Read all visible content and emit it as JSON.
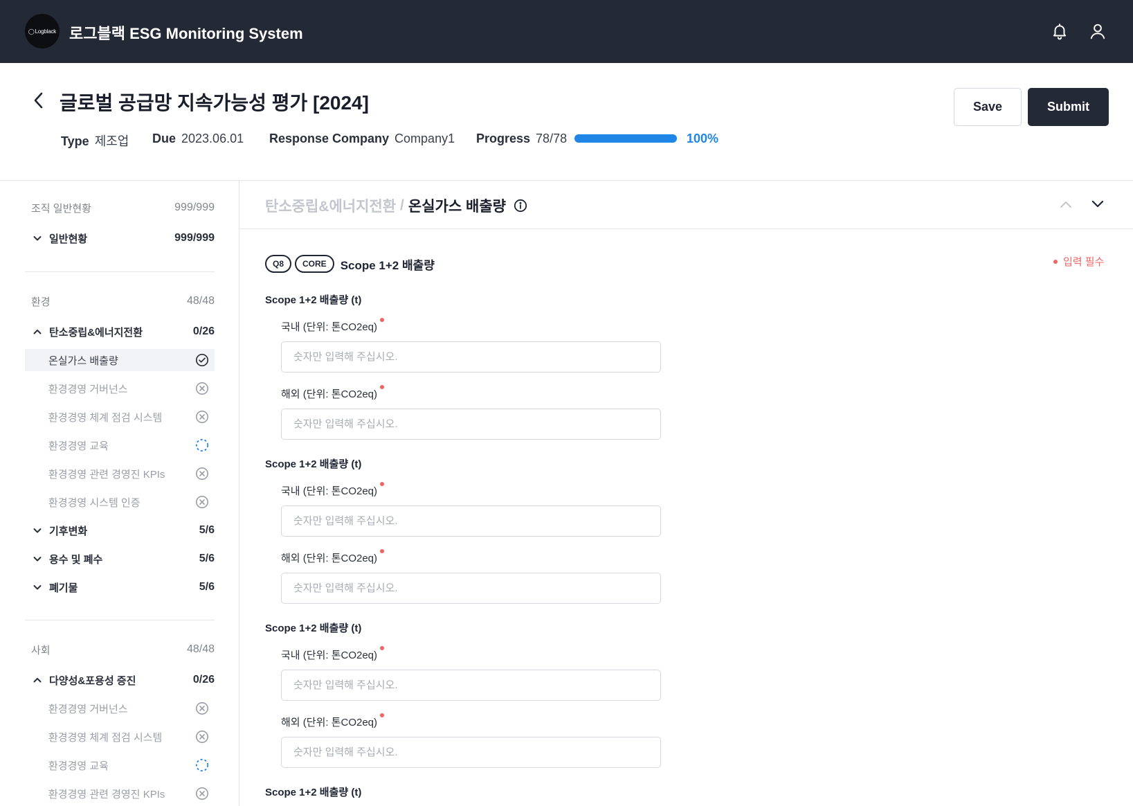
{
  "app": {
    "logo_text": "Logblack",
    "title": "로그블랙 ESG Monitoring System"
  },
  "header": {
    "title": "글로벌 공급망 지속가능성 평가 [2024]",
    "meta": {
      "type_label": "Type",
      "type_value": "제조업",
      "due_label": "Due",
      "due_value": "2023.06.01",
      "company_label": "Response Company",
      "company_value": "Company1",
      "progress_label": "Progress",
      "progress_value": "78/78",
      "progress_fraction": 1.0,
      "progress_percent": "100%"
    },
    "save_label": "Save",
    "submit_label": "Submit"
  },
  "sidebar": {
    "org_section": {
      "label": "조직 일반현황",
      "count": "999/999"
    },
    "org_groups": [
      {
        "label": "일반현황",
        "count": "999/999",
        "expanded": false
      }
    ],
    "env_section": {
      "label": "환경",
      "count": "48/48"
    },
    "env_groups": [
      {
        "label": "탄소중립&에너지전환",
        "count": "0/26",
        "expanded": true,
        "items": [
          {
            "label": "온실가스 배출량",
            "status": "done",
            "active": true
          },
          {
            "label": "환경경영 거버넌스",
            "status": "incomplete"
          },
          {
            "label": "환경경영 체계 점검 시스템",
            "status": "incomplete"
          },
          {
            "label": "환경경영 교육",
            "status": "in-progress"
          },
          {
            "label": "환경경영 관련 경영진 KPIs",
            "status": "incomplete"
          },
          {
            "label": "환경경영 시스템 인증",
            "status": "incomplete"
          }
        ]
      },
      {
        "label": "기후변화",
        "count": "5/6",
        "expanded": false
      },
      {
        "label": "용수 및 폐수",
        "count": "5/6",
        "expanded": false
      },
      {
        "label": "폐기물",
        "count": "5/6",
        "expanded": false
      }
    ],
    "social_section": {
      "label": "사회",
      "count": "48/48"
    },
    "social_groups": [
      {
        "label": "다양성&포용성 증진",
        "count": "0/26",
        "expanded": true,
        "items": [
          {
            "label": "환경경영 거버넌스",
            "status": "incomplete"
          },
          {
            "label": "환경경영 체계 점검 시스템",
            "status": "incomplete"
          },
          {
            "label": "환경경영 교육",
            "status": "in-progress"
          },
          {
            "label": "환경경영 관련 경영진 KPIs",
            "status": "incomplete"
          }
        ]
      }
    ]
  },
  "main": {
    "breadcrumb": {
      "parent": "탄소중립&에너지전환",
      "separator": "/",
      "current": "온실가스 배출량"
    },
    "question": {
      "number": "Q8",
      "tag": "CORE",
      "title": "Scope 1+2 배출량",
      "required_note": "입력 필수"
    },
    "groups": [
      {
        "title": "Scope 1+2 배출량 (t)",
        "fields": [
          {
            "label": "국내 (단위: 톤CO2eq)",
            "placeholder": "숫자만 입력해 주십시오.",
            "value": ""
          },
          {
            "label": "해외 (단위: 톤CO2eq)",
            "placeholder": "숫자만 입력해 주십시오.",
            "value": ""
          }
        ]
      },
      {
        "title": "Scope 1+2 배출량 (t)",
        "fields": [
          {
            "label": "국내 (단위: 톤CO2eq)",
            "placeholder": "숫자만 입력해 주십시오.",
            "value": ""
          },
          {
            "label": "해외 (단위: 톤CO2eq)",
            "placeholder": "숫자만 입력해 주십시오.",
            "value": ""
          }
        ]
      },
      {
        "title": "Scope 1+2 배출량 (t)",
        "fields": [
          {
            "label": "국내 (단위: 톤CO2eq)",
            "placeholder": "숫자만 입력해 주십시오.",
            "value": ""
          },
          {
            "label": "해외 (단위: 톤CO2eq)",
            "placeholder": "숫자만 입력해 주십시오.",
            "value": ""
          }
        ]
      },
      {
        "title": "Scope 1+2 배출량 (t)",
        "fields": []
      }
    ]
  },
  "colors": {
    "topbar": "#242936",
    "accent": "#1f86e8",
    "required": "#f06464",
    "muted": "#9a9ea8"
  },
  "icons": {
    "notification": "bell-icon",
    "account": "user-icon",
    "back": "chevron-left-icon",
    "info": "info-icon",
    "collapse": "chevron-up-icon",
    "expand": "chevron-down-icon",
    "done": "check-circle-icon",
    "incomplete": "x-circle-icon",
    "in_progress": "dashed-circle-icon"
  }
}
